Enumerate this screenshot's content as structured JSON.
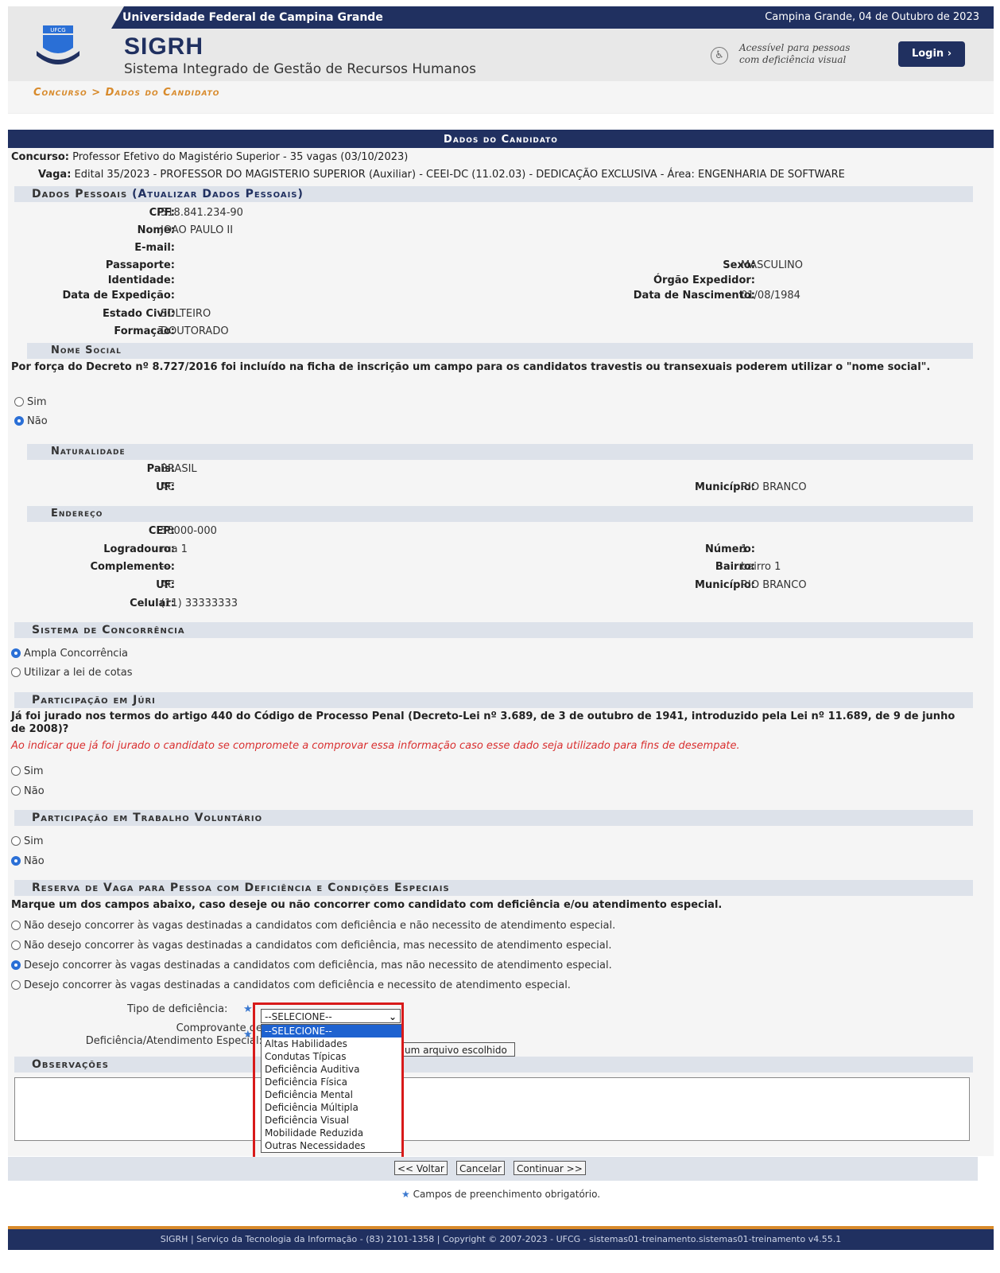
{
  "header": {
    "university": "Universidade Federal de Campina Grande",
    "date": "Campina Grande, 04 de Outubro de 2023",
    "logo_text": "UFCG",
    "system": "SIGRH",
    "system_name": "Sistema Integrado de Gestão de Recursos Humanos",
    "accessibility_line1": "Acessível para pessoas",
    "accessibility_line2": "com deficiência visual",
    "login": "Login  ›"
  },
  "breadcrumb": "Concurso > Dados do Candidato",
  "caption": "Dados do Candidato",
  "concurso": {
    "label": "Concurso:",
    "value": "Professor Efetivo do Magistério Superior - 35 vagas (03/10/2023)"
  },
  "vaga": {
    "label": "Vaga:",
    "value": "Edital 35/2023 - PROFESSOR DO MAGISTERIO SUPERIOR (Auxiliar) - CEEI-DC (11.02.03) - DEDICAÇÃO EXCLUSIVA - Área: ENGENHARIA DE SOFTWARE"
  },
  "dados_pessoais": {
    "title": "Dados Pessoais",
    "link": "(Atualizar Dados Pessoais)",
    "cpf_l": "CPF:",
    "cpf": "518.841.234-90",
    "nome_l": "Nome:",
    "nome": "JOAO PAULO II",
    "email_l": "E-mail:",
    "passaporte_l": "Passaporte:",
    "sexo_l": "Sexo:",
    "sexo": "MASCULINO",
    "identidade_l": "Identidade:",
    "orgao_l": "Órgão Expedidor:",
    "data_exp_l": "Data de Expedição:",
    "nasc_l": "Data de Nascimento:",
    "nasc": "01/08/1984",
    "estado_l": "Estado Civil:",
    "estado": "SOLTEIRO",
    "formacao_l": "Formação:",
    "formacao": "DOUTORADO"
  },
  "nome_social": {
    "title": "Nome Social",
    "text": "Por força do Decreto nº 8.727/2016 foi incluído na ficha de inscrição um campo para os candidatos travestis ou transexuais poderem utilizar o \"nome social\".",
    "sim": "Sim",
    "nao": "Não"
  },
  "naturalidade": {
    "title": "Naturalidade",
    "pais_l": "País:",
    "pais": "BRASIL",
    "uf_l": "UF:",
    "uf": "AC",
    "mun_l": "Município:",
    "mun": "RIO BRANCO"
  },
  "endereco": {
    "title": "Endereço",
    "cep_l": "CEP:",
    "cep": "58000-000",
    "log_l": "Logradouro:",
    "log": "rua 1",
    "num_l": "Número:",
    "num": "1",
    "comp_l": "Complemento:",
    "comp": "---",
    "bairro_l": "Bairro:",
    "bairro": "bairro 1",
    "uf_l": "UF:",
    "uf": "AC",
    "mun_l": "Município:",
    "mun": "RIO BRANCO",
    "cel_l": "Celular:",
    "cel": "(11) 33333333"
  },
  "concorrencia": {
    "title": "Sistema de Concorrência",
    "ampla": "Ampla Concorrência",
    "cotas": "Utilizar a lei de cotas"
  },
  "juri": {
    "title": "Participação em Júri",
    "text": "Já foi jurado nos termos do artigo 440 do Código de Processo Penal (Decreto-Lei nº 3.689, de 3 de outubro de 1941, introduzido pela Lei nº 11.689, de 9 de junho de 2008)?",
    "warning": "Ao indicar que já foi jurado o candidato se compromete a comprovar essa informação caso esse dado seja utilizado para fins de desempate.",
    "sim": "Sim",
    "nao": "Não"
  },
  "voluntario": {
    "title": "Participação em Trabalho Voluntário",
    "sim": "Sim",
    "nao": "Não"
  },
  "reserva": {
    "title": "Reserva de Vaga para Pessoa com Deficiência e Condições Especiais",
    "text": "Marque um dos campos abaixo, caso deseje ou não concorrer como candidato com deficiência e/ou atendimento especial.",
    "opt1": "Não desejo concorrer às vagas destinadas a candidatos com deficiência e não necessito de atendimento especial.",
    "opt2": "Não desejo concorrer às vagas destinadas a candidatos com deficiência, mas necessito de atendimento especial.",
    "opt3": "Desejo concorrer às vagas destinadas a candidatos com deficiência, mas não necessito de atendimento especial.",
    "opt4": "Desejo concorrer às vagas destinadas a candidatos com deficiência e necessito de atendimento especial.",
    "tipo_l": "Tipo de deficiência:",
    "comprov_l1": "Comprovante de",
    "comprov_l2": "Deficiência/Atendimento Especial:",
    "file_text": "um arquivo escolhido",
    "select_value": "--SELECIONE--",
    "options": [
      "--SELECIONE--",
      "Altas Habilidades",
      "Condutas Típicas",
      "Deficiência Auditiva",
      "Deficiência Física",
      "Deficiência Mental",
      "Deficiência Múltipla",
      "Deficiência Visual",
      "Mobilidade Reduzida",
      "Outras Necessidades"
    ]
  },
  "observacoes": {
    "title": "Observações"
  },
  "buttons": {
    "voltar": "<< Voltar",
    "cancelar": "Cancelar",
    "continuar": "Continuar >>"
  },
  "note": "Campos de preenchimento obrigatório.",
  "footer": "SIGRH | Serviço da Tecnologia da Informação - (83) 2101-1358 | Copyright © 2007-2023 - UFCG - sistemas01-treinamento.sistemas01-treinamento v4.55.1",
  "colors": {
    "navy": "#203060",
    "accent": "#d88a2b",
    "required": "#3a78d0",
    "warning": "#d93030",
    "highlight": "#d81a1a"
  }
}
